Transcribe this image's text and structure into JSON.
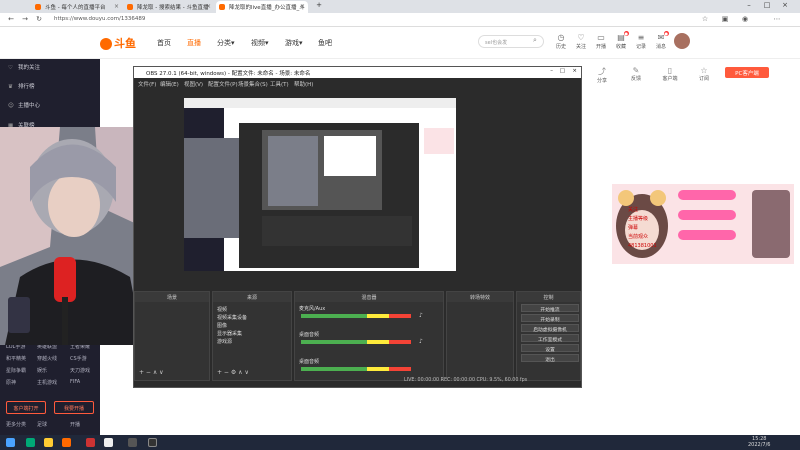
{
  "browser": {
    "tabs": [
      {
        "title": "斗鱼 - 每个人的直播平台"
      },
      {
        "title": "降龙取 - 搜索结果 - 斗鱼直播"
      },
      {
        "title": "降龙取的live直播_办公直播_斗"
      }
    ],
    "url": "https://www.douyu.com/1336489"
  },
  "site": {
    "logo": "斗鱼",
    "nav": [
      "首页",
      "直播",
      "分类",
      "视频",
      "游戏",
      "鱼吧"
    ],
    "search_placeholder": "sel也会发",
    "header_icons": [
      "历史",
      "关注",
      "开播",
      "收藏",
      "记录",
      "消息"
    ]
  },
  "sidebar": {
    "items": [
      "我的关注",
      "排行榜",
      "主播中心",
      "关联榜"
    ],
    "grid": [
      "LOL手游",
      "英雄联盟",
      "王者荣耀",
      "和平精英",
      "穿越火线",
      "CS手游",
      "星际争霸",
      "娱乐",
      "天刀游戏",
      "原神",
      "主机游戏",
      "FIFA",
      "更多分类",
      "足球",
      "开播"
    ],
    "btn_left": "客户端打开",
    "btn_right": "我要开播"
  },
  "right": {
    "icons": [
      "分享",
      "反馈",
      "客户端",
      "订阅"
    ],
    "pc_btn": "PC客户端",
    "chat": [
      "关注",
      "主播等级",
      "弹幕",
      "当前观众",
      "481381001"
    ]
  },
  "obs": {
    "title": "OBS 27.0.1 (64-bit, windows) - 配置文件: 未命名 - 场景: 未命名",
    "menu": [
      "文件(F)",
      "编辑(E)",
      "视图(V)",
      "配置文件(P)",
      "场景集合(S)",
      "工具(T)",
      "帮助(H)"
    ],
    "docks": [
      "场景",
      "来源",
      "混音器",
      "转场特效",
      "控制"
    ],
    "sources": [
      "视频",
      "视频采集设备",
      "图像",
      "显示器采集",
      "游戏源"
    ],
    "mixer": [
      "麦克风/Aux",
      "桌面音频",
      "桌面音频"
    ],
    "controls": [
      "开始推流",
      "开始录制",
      "启动虚拟摄像机",
      "工作室模式",
      "设置",
      "退出"
    ],
    "status": "LIVE: 00:00:00   REC: 00:00:00   CPU: 9.5%, 60.00 fps"
  },
  "taskbar": {
    "time": "15:28",
    "date": "2022/7/6"
  }
}
